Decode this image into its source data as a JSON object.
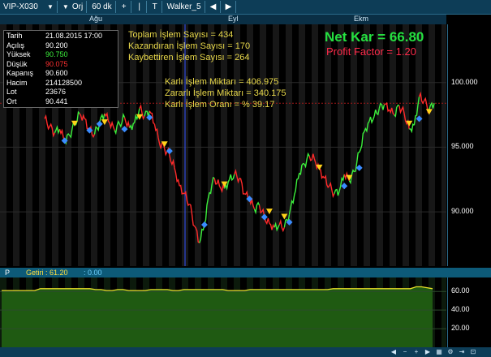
{
  "toolbar": {
    "symbol": "VIP-X030",
    "orj": "Orj",
    "period": "60 dk",
    "plus": "+",
    "pipe": "|",
    "text_tool": "T",
    "system": "Walker_5"
  },
  "months": [
    {
      "label": "Ağu"
    },
    {
      "label": "Eyl"
    },
    {
      "label": "Ekm"
    }
  ],
  "info": {
    "rows": [
      {
        "k": "Tarih",
        "v": "21.08.2015 17:00",
        "color": "#ffffff"
      },
      {
        "k": "Açılış",
        "v": "90.200",
        "color": "#ffffff"
      },
      {
        "k": "Yüksek",
        "v": "90.750",
        "color": "#3cf03c"
      },
      {
        "k": "Düşük",
        "v": "90.075",
        "color": "#ff3030"
      },
      {
        "k": "Kapanış",
        "v": "90.600",
        "color": "#ffffff"
      },
      {
        "k": "Hacim",
        "v": "214128500",
        "color": "#ffffff"
      },
      {
        "k": "Lot",
        "v": "23676",
        "color": "#ffffff"
      },
      {
        "k": "Ort",
        "v": "90.441",
        "color": "#ffffff"
      }
    ]
  },
  "stats": {
    "toplam": "Toplam İşlem Sayısı =  434",
    "kazandiran": "Kazandıran İşlem Sayısı =  170",
    "kaybettiren": "Kaybettiren İşlem Sayısı =  264",
    "karli_miktar": "Karlı İşlem Miktarı =  406.975",
    "zararli_miktar": "Zararlı İşlem Miktarı =  340.175",
    "karli_oran": "Karlı İşlem Oranı = % 39.17",
    "net_kar": "Net Kar =  66.80",
    "profit_factor": "Profit Factor =  1.20"
  },
  "price_axis": [
    {
      "label": "100.000",
      "value": 100
    },
    {
      "label": "95.000",
      "value": 95
    },
    {
      "label": "90.000",
      "value": 90
    }
  ],
  "sub": {
    "panel_letter": "P",
    "getiri": "Getiri : 61.20",
    "second": ": 0.00",
    "axis": [
      {
        "label": "60.00",
        "value": 60
      },
      {
        "label": "40.00",
        "value": 40
      },
      {
        "label": "20.00",
        "value": 20
      }
    ]
  },
  "colors": {
    "up": "#3cf03c",
    "down": "#ff2a2a",
    "buy": "#3a8cff",
    "sell": "#ffd21a",
    "equity_fill": "#1f5a12",
    "equity_line": "#e8e028"
  },
  "chart_data": {
    "type": "line",
    "ylim": [
      85.8,
      104.5
    ],
    "price": [
      97.2,
      96.6,
      96.1,
      96.4,
      95.5,
      95.9,
      96.8,
      97.6,
      97.2,
      96.3,
      96.0,
      96.9,
      97.6,
      96.9,
      96.3,
      96.8,
      97.3,
      96.5,
      96.9,
      98.0,
      97.4,
      97.8,
      96.8,
      95.3,
      94.9,
      94.4,
      93.4,
      92.0,
      91.4,
      90.6,
      88.9,
      87.6,
      89.0,
      91.5,
      92.6,
      92.0,
      91.8,
      92.5,
      92.9,
      92.6,
      91.4,
      91.0,
      90.2,
      90.5,
      89.6,
      89.1,
      88.8,
      89.0,
      88.8,
      89.8,
      91.3,
      93.0,
      93.7,
      94.3,
      94.1,
      93.3,
      92.6,
      92.0,
      91.4,
      91.6,
      92.9,
      92.4,
      93.1,
      94.6,
      96.2,
      97.0,
      97.4,
      98.0,
      98.3,
      97.9,
      97.5,
      98.2,
      97.6,
      96.4,
      96.7,
      98.9,
      98.6,
      97.9,
      98.4
    ],
    "markers": [
      {
        "type": "buy",
        "i": 4,
        "price": 95.5
      },
      {
        "type": "sell",
        "i": 6,
        "price": 96.8
      },
      {
        "type": "buy",
        "i": 9,
        "price": 96.3
      },
      {
        "type": "buy",
        "i": 11,
        "price": 96.8
      },
      {
        "type": "sell",
        "i": 12,
        "price": 96.9
      },
      {
        "type": "buy",
        "i": 16,
        "price": 96.4
      },
      {
        "type": "sell",
        "i": 19,
        "price": 97.3
      },
      {
        "type": "buy",
        "i": 21,
        "price": 97.3
      },
      {
        "type": "sell",
        "i": 24,
        "price": 95.2
      },
      {
        "type": "buy",
        "i": 25,
        "price": 94.7
      },
      {
        "type": "buy",
        "i": 32,
        "price": 89.0
      },
      {
        "type": "sell",
        "i": 36,
        "price": 92.1
      },
      {
        "type": "buy",
        "i": 41,
        "price": 91.0
      },
      {
        "type": "buy",
        "i": 44,
        "price": 89.6
      },
      {
        "type": "sell",
        "i": 45,
        "price": 90.0
      },
      {
        "type": "sell",
        "i": 48,
        "price": 89.6
      },
      {
        "type": "buy",
        "i": 49,
        "price": 89.2
      },
      {
        "type": "sell",
        "i": 55,
        "price": 93.4
      },
      {
        "type": "buy",
        "i": 60,
        "price": 92.0
      },
      {
        "type": "sell",
        "i": 61,
        "price": 92.6
      },
      {
        "type": "buy",
        "i": 63,
        "price": 93.4
      },
      {
        "type": "sell",
        "i": 73,
        "price": 96.8
      },
      {
        "type": "buy",
        "i": 75,
        "price": 97.2
      },
      {
        "type": "sell",
        "i": 77,
        "price": 97.7
      }
    ],
    "equity_ylim": [
      0,
      75
    ],
    "equity": [
      61,
      61,
      61,
      61,
      61,
      61,
      61,
      63,
      63,
      63,
      63,
      63,
      63,
      63,
      63,
      63,
      63,
      62,
      62,
      61,
      61,
      62,
      62,
      61,
      61,
      61,
      61,
      62,
      62,
      62,
      62,
      61,
      61,
      62,
      62,
      62,
      62,
      62,
      62,
      62,
      62,
      61,
      61,
      61,
      61,
      62,
      62,
      62,
      62,
      62,
      62,
      62,
      62,
      62,
      62,
      62,
      62,
      62,
      62,
      62,
      63,
      63,
      63,
      63,
      63,
      63,
      63,
      63,
      63,
      63,
      63,
      63,
      63,
      63,
      63,
      65,
      65,
      64,
      63
    ]
  }
}
